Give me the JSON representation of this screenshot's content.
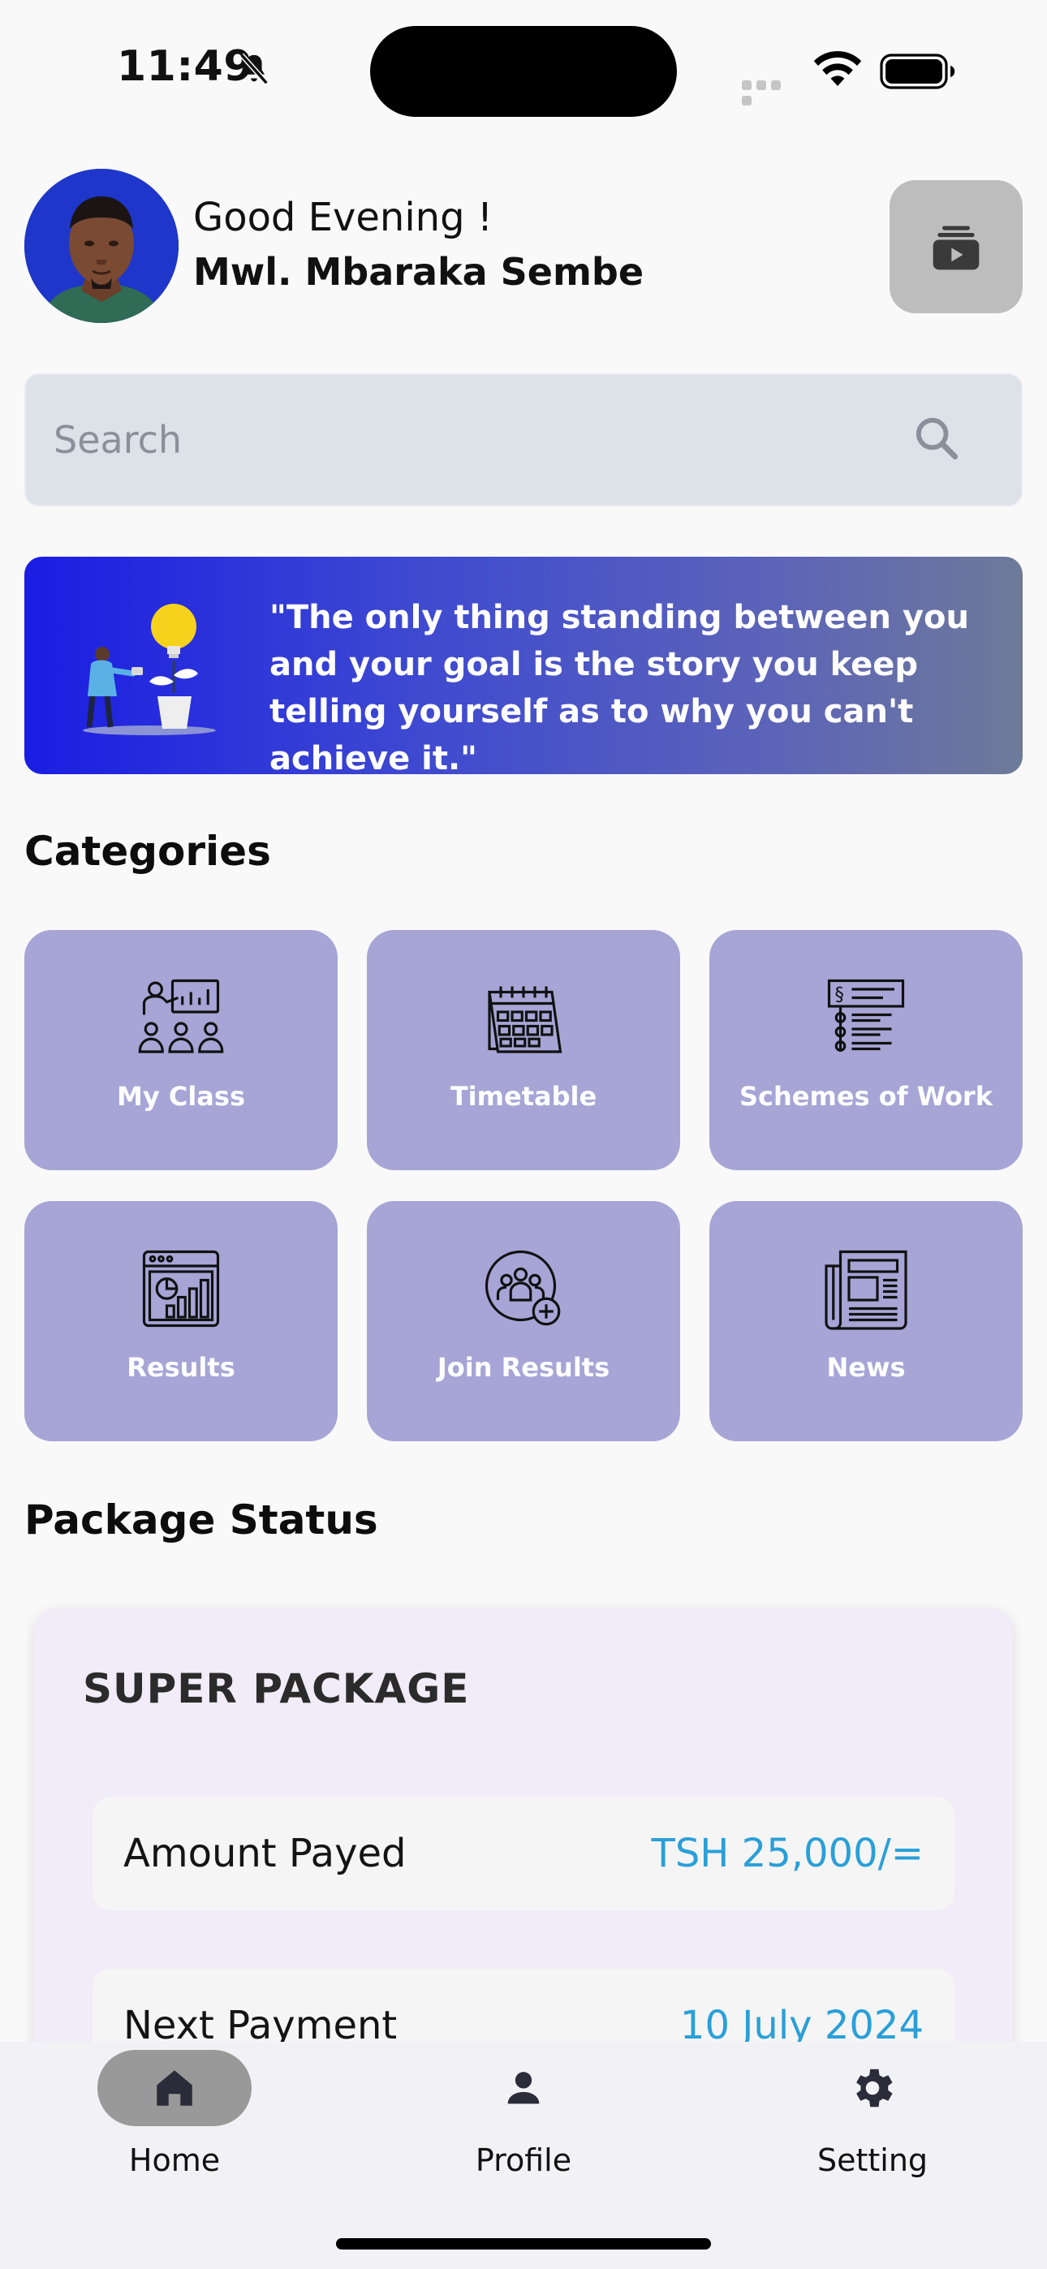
{
  "status_bar": {
    "time": "11:49"
  },
  "header": {
    "greeting": "Good Evening !",
    "username": "Mwl. Mbaraka Sembe"
  },
  "search": {
    "placeholder": "Search"
  },
  "banner": {
    "quote": "\"The only thing standing between you and your goal is the story you keep telling yourself as to why you can't achieve it.\""
  },
  "categories": {
    "title": "Categories",
    "items": [
      {
        "label": "My Class",
        "icon": "classroom-icon"
      },
      {
        "label": "Timetable",
        "icon": "calendar-icon"
      },
      {
        "label": "Schemes of Work",
        "icon": "checklist-icon"
      },
      {
        "label": "Results",
        "icon": "analytics-icon"
      },
      {
        "label": "Join Results",
        "icon": "group-add-icon"
      },
      {
        "label": "News",
        "icon": "newspaper-icon"
      }
    ]
  },
  "package": {
    "section_title": "Package Status",
    "name": "SUPER PACKAGE",
    "rows": [
      {
        "label": "Amount Payed",
        "value": "TSH 25,000/="
      },
      {
        "label": "Next Payment",
        "value": "10 July 2024"
      }
    ]
  },
  "bottom_nav": {
    "items": [
      {
        "label": "Home",
        "icon": "home-icon",
        "active": true
      },
      {
        "label": "Profile",
        "icon": "person-icon",
        "active": false
      },
      {
        "label": "Setting",
        "icon": "gear-icon",
        "active": false
      }
    ]
  },
  "colors": {
    "category_bg": "#a6a5d6",
    "accent_value": "#2a9fd8",
    "banner_start": "#1a1de3",
    "banner_end": "#6e7a99"
  }
}
